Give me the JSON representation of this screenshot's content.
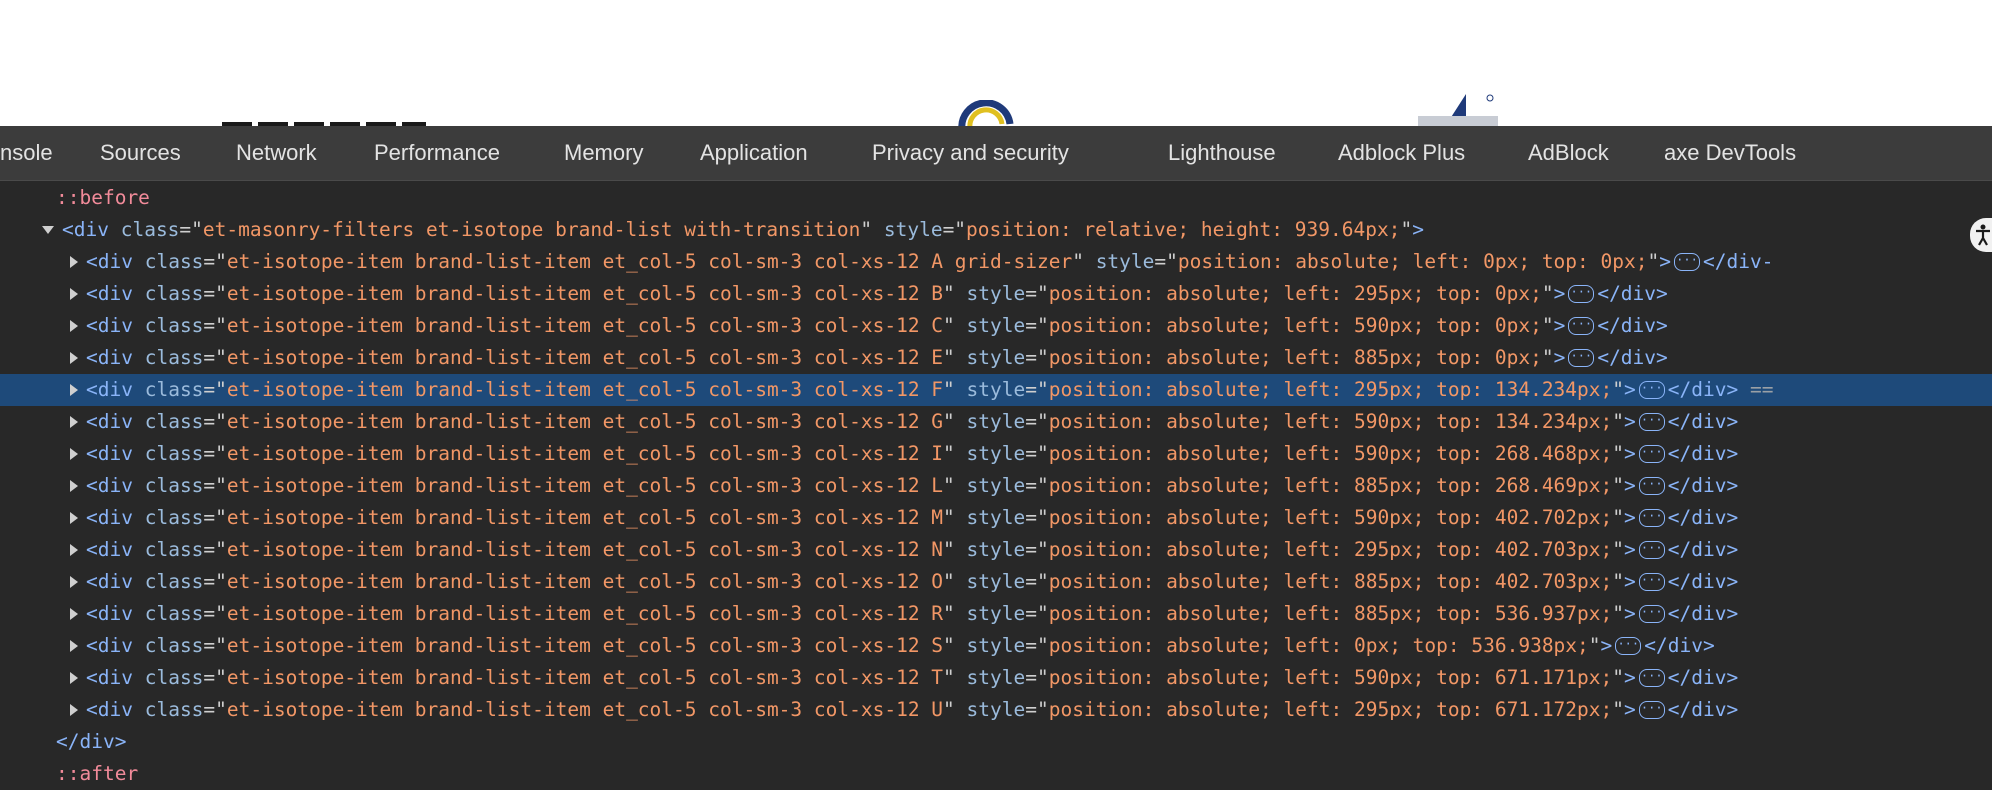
{
  "colors": {
    "panel_bg": "#282828",
    "tabbar_bg": "#3c3c3c",
    "selected_row_bg": "#1e4a7a",
    "tag_color": "#8ab4f8",
    "attr_value_color": "#f29766",
    "pseudo_color": "#f28b9a"
  },
  "tabs": [
    {
      "label": "nsole"
    },
    {
      "label": "Sources"
    },
    {
      "label": "Network"
    },
    {
      "label": "Performance"
    },
    {
      "label": "Memory"
    },
    {
      "label": "Application"
    },
    {
      "label": "Privacy and security"
    },
    {
      "label": "Lighthouse"
    },
    {
      "label": "Adblock Plus"
    },
    {
      "label": "AdBlock"
    },
    {
      "label": "axe DevTools"
    }
  ],
  "tree": {
    "before": "::before",
    "after": "::after",
    "parent_open": "<div",
    "parent_close_tag": "</div>",
    "parent_class_attr": "class",
    "parent_class_value": "et-masonry-filters et-isotope brand-list with-transition",
    "parent_style_attr": "style",
    "parent_style_value": "position: relative; height: 939.64px;",
    "gt": ">",
    "child_open": "<div",
    "child_close": "</div>",
    "child_class_attr": "class",
    "child_style_attr": "style",
    "selected_suffix": "==",
    "ellipsis_glyph": "···",
    "children": [
      {
        "class_value": "et-isotope-item brand-list-item et_col-5 col-sm-3 col-xs-12 A grid-sizer",
        "style_value": "position: absolute; left: 0px; top: 0px;",
        "close": "</div-"
      },
      {
        "class_value": "et-isotope-item brand-list-item et_col-5 col-sm-3 col-xs-12 B",
        "style_value": "position: absolute; left: 295px; top: 0px;"
      },
      {
        "class_value": "et-isotope-item brand-list-item et_col-5 col-sm-3 col-xs-12 C",
        "style_value": "position: absolute; left: 590px; top: 0px;"
      },
      {
        "class_value": "et-isotope-item brand-list-item et_col-5 col-sm-3 col-xs-12 E",
        "style_value": "position: absolute; left: 885px; top: 0px;"
      },
      {
        "class_value": "et-isotope-item brand-list-item et_col-5 col-sm-3 col-xs-12 F",
        "style_value": "position: absolute; left: 295px; top: 134.234px;",
        "selected": true
      },
      {
        "class_value": "et-isotope-item brand-list-item et_col-5 col-sm-3 col-xs-12 G",
        "style_value": "position: absolute; left: 590px; top: 134.234px;"
      },
      {
        "class_value": "et-isotope-item brand-list-item et_col-5 col-sm-3 col-xs-12 I",
        "style_value": "position: absolute; left: 590px; top: 268.468px;"
      },
      {
        "class_value": "et-isotope-item brand-list-item et_col-5 col-sm-3 col-xs-12 L",
        "style_value": "position: absolute; left: 885px; top: 268.469px;"
      },
      {
        "class_value": "et-isotope-item brand-list-item et_col-5 col-sm-3 col-xs-12 M",
        "style_value": "position: absolute; left: 590px; top: 402.702px;"
      },
      {
        "class_value": "et-isotope-item brand-list-item et_col-5 col-sm-3 col-xs-12 N",
        "style_value": "position: absolute; left: 295px; top: 402.703px;"
      },
      {
        "class_value": "et-isotope-item brand-list-item et_col-5 col-sm-3 col-xs-12 O",
        "style_value": "position: absolute; left: 885px; top: 402.703px;"
      },
      {
        "class_value": "et-isotope-item brand-list-item et_col-5 col-sm-3 col-xs-12 R",
        "style_value": "position: absolute; left: 885px; top: 536.937px;"
      },
      {
        "class_value": "et-isotope-item brand-list-item et_col-5 col-sm-3 col-xs-12 S",
        "style_value": "position: absolute; left: 0px; top: 536.938px;"
      },
      {
        "class_value": "et-isotope-item brand-list-item et_col-5 col-sm-3 col-xs-12 T",
        "style_value": "position: absolute; left: 590px; top: 671.171px;"
      },
      {
        "class_value": "et-isotope-item brand-list-item et_col-5 col-sm-3 col-xs-12 U",
        "style_value": "position: absolute; left: 295px; top: 671.172px;"
      }
    ]
  }
}
